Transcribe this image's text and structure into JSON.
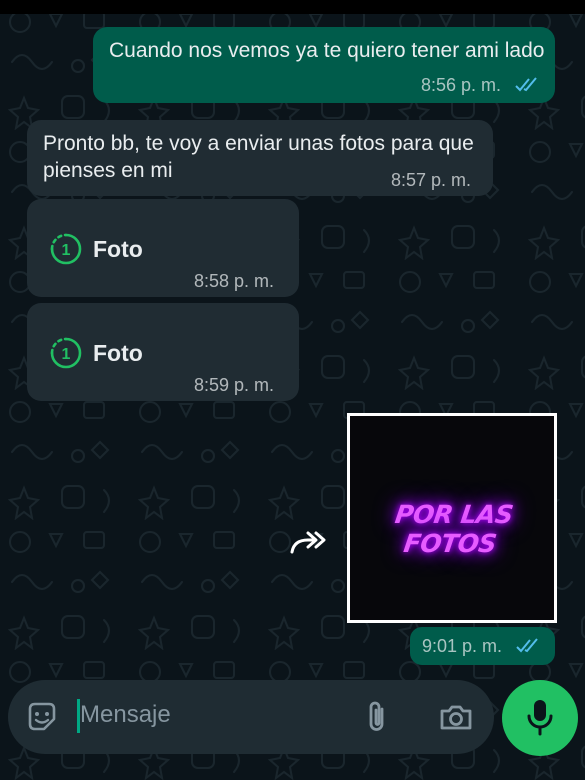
{
  "messages": [
    {
      "direction": "outgoing",
      "type": "text",
      "text": "Cuando nos vemos ya te quiero tener ami lado",
      "time": "8:56 p. m.",
      "status": "read-double-check"
    },
    {
      "direction": "incoming",
      "type": "text",
      "text": "Pronto bb, te voy a enviar unas fotos para que pienses en mi",
      "time": "8:57 p. m."
    },
    {
      "direction": "incoming",
      "type": "view-once-photo",
      "label": "Foto",
      "badge": "1",
      "time": "8:58 p. m."
    },
    {
      "direction": "incoming",
      "type": "view-once-photo",
      "label": "Foto",
      "badge": "1",
      "time": "8:59 p. m."
    },
    {
      "direction": "outgoing",
      "type": "image",
      "image_text": "POR LAS FOTOS",
      "time": "9:01 p. m.",
      "status": "read-double-check"
    }
  ],
  "composer": {
    "placeholder": "Mensaje",
    "icons": [
      "sticker-icon",
      "attach-icon",
      "camera-icon",
      "mic-icon"
    ]
  },
  "colors": {
    "background": "#0b141a",
    "outgoing_bubble": "#005c4b",
    "incoming_bubble": "#202c33",
    "read_ticks": "#53bdeb",
    "view_once_accent": "#21c063",
    "mic_button": "#21c063",
    "neon_text": "#e65cff"
  }
}
